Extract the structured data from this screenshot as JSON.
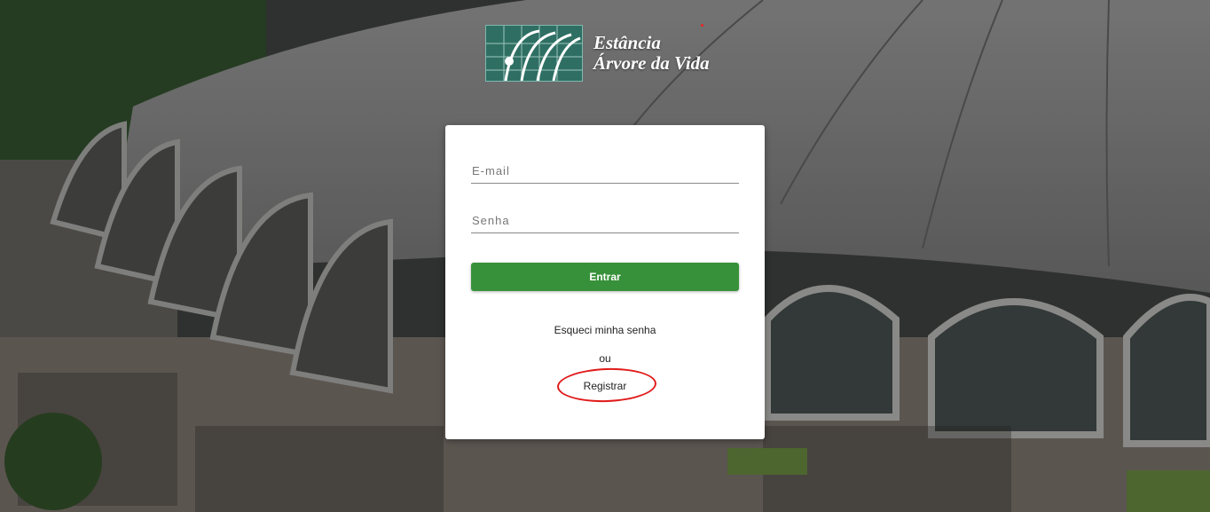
{
  "brand": {
    "line1": "Estância",
    "line2": "Árvore da Vida"
  },
  "login": {
    "email_placeholder": "E-mail",
    "password_placeholder": "Senha",
    "submit_label": "Entrar",
    "forgot_label": "Esqueci minha senha",
    "or_label": "ou",
    "register_label": "Registrar"
  },
  "colors": {
    "primary_button": "#37913a",
    "annotation_circle": "#e11b1b"
  }
}
